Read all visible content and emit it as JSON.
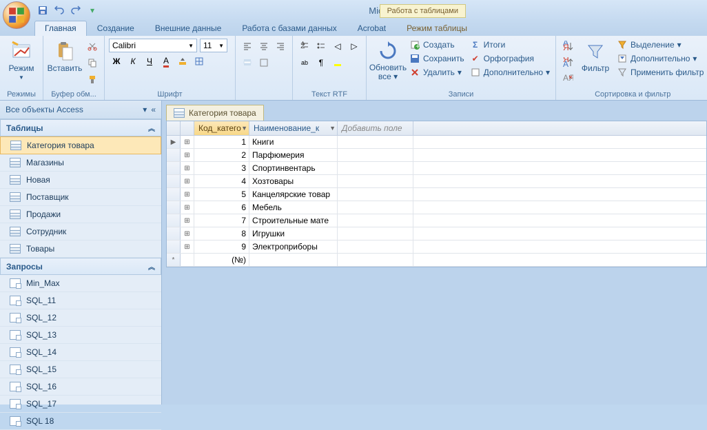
{
  "app_title": "Microsoft Access",
  "context_title": "Работа с таблицами",
  "tabs": [
    "Главная",
    "Создание",
    "Внешние данные",
    "Работа с базами данных",
    "Acrobat",
    "Режим таблицы"
  ],
  "active_tab": 0,
  "ribbon": {
    "views": {
      "label": "Режимы",
      "btn": "Режим"
    },
    "clipboard": {
      "label": "Буфер обм...",
      "paste": "Вставить"
    },
    "font": {
      "label": "Шрифт",
      "family": "Calibri",
      "size": "11"
    },
    "rtf": {
      "label": "Текст RTF"
    },
    "records": {
      "label": "Записи",
      "refresh": "Обновить\nвсе",
      "new": "Создать",
      "save": "Сохранить",
      "delete": "Удалить",
      "totals": "Итоги",
      "spelling": "Орфография",
      "more": "Дополнительно"
    },
    "sortfilter": {
      "label": "Сортировка и фильтр",
      "filter": "Фильтр",
      "selection": "Выделение",
      "advanced": "Дополнительно",
      "toggle": "Применить фильтр"
    }
  },
  "nav": {
    "title": "Все объекты Access",
    "sections": [
      {
        "name": "Таблицы",
        "items": [
          "Категория товара",
          "Магазины",
          "Новая",
          "Поставщик",
          "Продажи",
          "Сотрудник",
          "Товары"
        ],
        "selected": 0,
        "type": "table"
      },
      {
        "name": "Запросы",
        "items": [
          "Min_Max",
          "SQL_11",
          "SQL_12",
          "SQL_13",
          "SQL_14",
          "SQL_15",
          "SQL_16",
          "SQL_17",
          "SQL 18"
        ],
        "type": "query"
      }
    ]
  },
  "doc": {
    "tab_title": "Категория товара",
    "columns": [
      "Код_катего",
      "Наименование_к",
      "Добавить поле"
    ],
    "rows": [
      {
        "id": "1",
        "name": "Книги"
      },
      {
        "id": "2",
        "name": "Парфюмерия"
      },
      {
        "id": "3",
        "name": "Спортинвентарь"
      },
      {
        "id": "4",
        "name": "Хозтовары"
      },
      {
        "id": "5",
        "name": "Канцелярские товар"
      },
      {
        "id": "6",
        "name": "Мебель"
      },
      {
        "id": "7",
        "name": "Строительные мате"
      },
      {
        "id": "8",
        "name": "Игрушки"
      },
      {
        "id": "9",
        "name": "Электроприборы"
      }
    ],
    "new_row_id": "(№)"
  }
}
